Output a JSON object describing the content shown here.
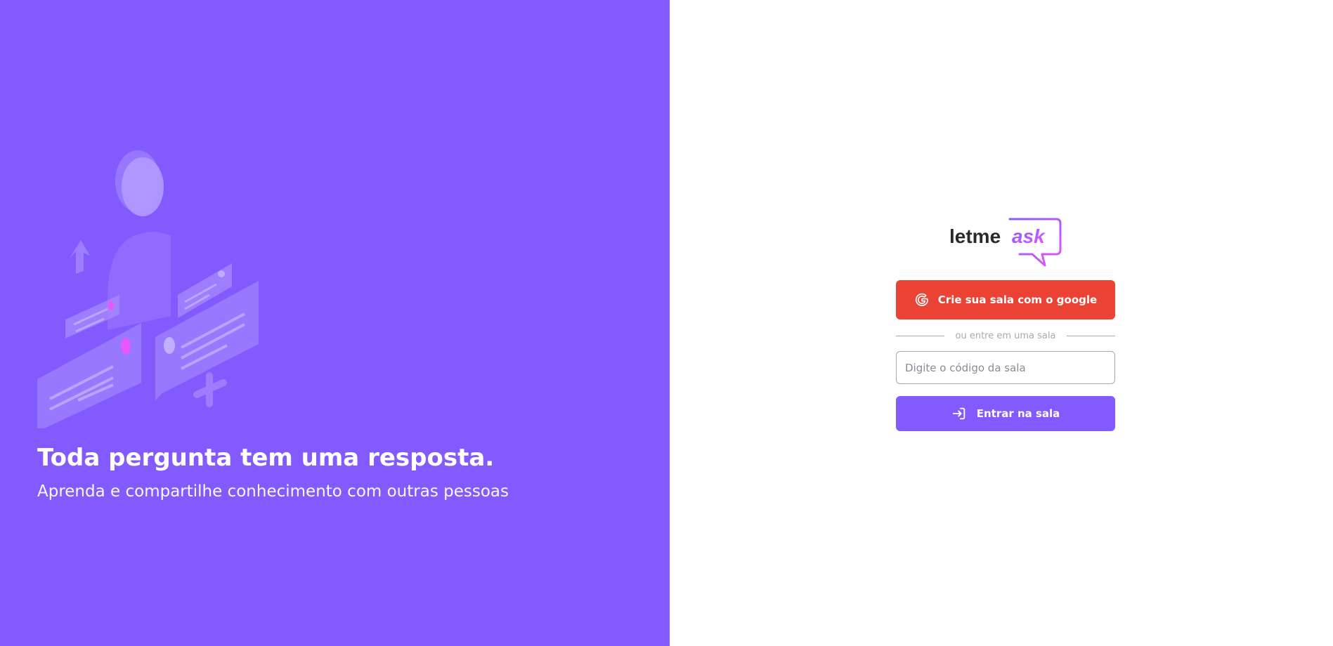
{
  "hero": {
    "title": "Toda pergunta tem uma resposta.",
    "subtitle": "Aprenda e compartilhe conhecimento com outras pessoas",
    "illustration_icon": "qa-illustration"
  },
  "logo": {
    "text_part1": "letme",
    "text_part2": "ask"
  },
  "google_button": {
    "label": "Crie sua sala com o google",
    "icon": "google-icon"
  },
  "separator": {
    "text": "ou entre em uma sala"
  },
  "room_input": {
    "placeholder": "Digite o código da sala",
    "value": ""
  },
  "enter_button": {
    "label": "Entrar na sala",
    "icon": "login-icon"
  },
  "colors": {
    "primary": "#835afd",
    "google": "#ea4335",
    "logo_dark": "#29292e",
    "logo_accent": "#e559f9",
    "muted": "#a8a8b3",
    "white": "#ffffff"
  }
}
